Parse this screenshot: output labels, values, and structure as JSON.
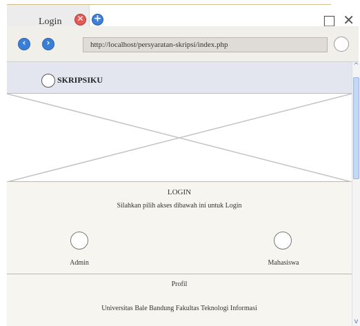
{
  "browser": {
    "tab_title": "Login",
    "tab_close_glyph": "✕",
    "new_tab_glyph": "+",
    "window_controls": "_ □ ✕",
    "back_glyph": "‹",
    "forward_glyph": "›",
    "url": "http://localhost/persyaratan-skripsi/index.php"
  },
  "header": {
    "brand": "SKRIPSIKU"
  },
  "login": {
    "title": "LOGIN",
    "subtitle": "Silahkan pilih akses dibawah ini untuk Login",
    "options": [
      {
        "label": "Admin"
      },
      {
        "label": "Mahasiswa"
      }
    ]
  },
  "profile": {
    "title": "Profil",
    "text": "Universitas Bale Bandung Fakultas Teknologi Informasi"
  },
  "scrollbar": {
    "up_glyph": "^",
    "down_glyph": "v"
  },
  "colors": {
    "nav_button": "#3b7ed8",
    "tab_close": "#e35b55",
    "header_bg": "#e3e6ef",
    "page_bg": "#f6f5f0"
  }
}
